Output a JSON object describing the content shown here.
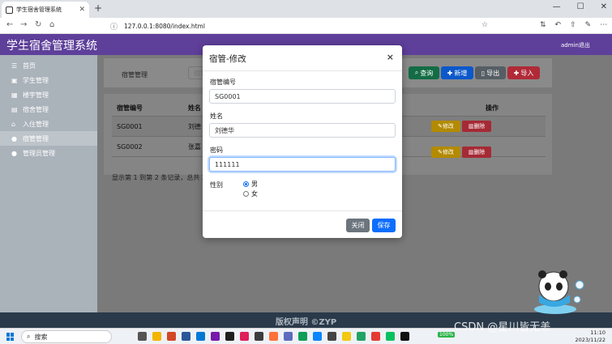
{
  "browser": {
    "tab_title": "学生宿舍管理系统",
    "tab_close": "✕",
    "new_tab": "+",
    "controls": [
      "—",
      "☐",
      "✕"
    ],
    "nav": [
      "←",
      "→",
      "↻",
      "⌂"
    ],
    "url": "127.0.0.1:8080/index.html",
    "ext_icons": [
      "⇅",
      "↶",
      "⇧",
      "✎",
      "⋯"
    ]
  },
  "app": {
    "title": "学生宿舍管理系统",
    "logout": "admin退出",
    "copyright": "版权声明 ©ZYP"
  },
  "sidebar": {
    "items": [
      {
        "label": "首页",
        "icon": "☰"
      },
      {
        "label": "学生管理",
        "icon": "▣"
      },
      {
        "label": "楼宇管理",
        "icon": "▦"
      },
      {
        "label": "宿舍管理",
        "icon": "▤"
      },
      {
        "label": "入住管理",
        "icon": "⌂"
      },
      {
        "label": "宿管管理",
        "icon": "●"
      },
      {
        "label": "管理员管理",
        "icon": "●"
      }
    ]
  },
  "toolbar": {
    "search_label": "宿管管理",
    "search_placeholder": "宿管",
    "query": "查询",
    "add": "新增",
    "export": "导出",
    "import": "导入"
  },
  "table": {
    "headers": [
      "宿管编号",
      "姓名",
      "操作"
    ],
    "rows": [
      {
        "id": "SG0001",
        "name": "刘德"
      },
      {
        "id": "SG0002",
        "name": "张嘉"
      }
    ],
    "edit": "修改",
    "delete": "删除",
    "pager": "显示第 1 到第 2 条记录，总共 2 条"
  },
  "modal": {
    "title": "宿管-修改",
    "close": "×",
    "id_label": "宿管编号",
    "id_value": "SG0001",
    "name_label": "姓名",
    "name_value": "刘德华",
    "password_label": "密码",
    "password_value": "111111",
    "gender_label": "性别",
    "gender_options": [
      "男",
      "女"
    ],
    "gender_selected": "男",
    "close_button": "关闭",
    "save_button": "保存"
  },
  "taskbar": {
    "search": "搜索",
    "time": "11:10",
    "date": "2023/11/22",
    "battery": "100%"
  },
  "watermark": "CSDN @星川皆无恙",
  "colors": {
    "header": "#5e3f9a",
    "success": "#198754",
    "primary": "#0d6efd",
    "secondary": "#6c757d",
    "danger": "#dc3545",
    "warning": "#ffc107"
  }
}
